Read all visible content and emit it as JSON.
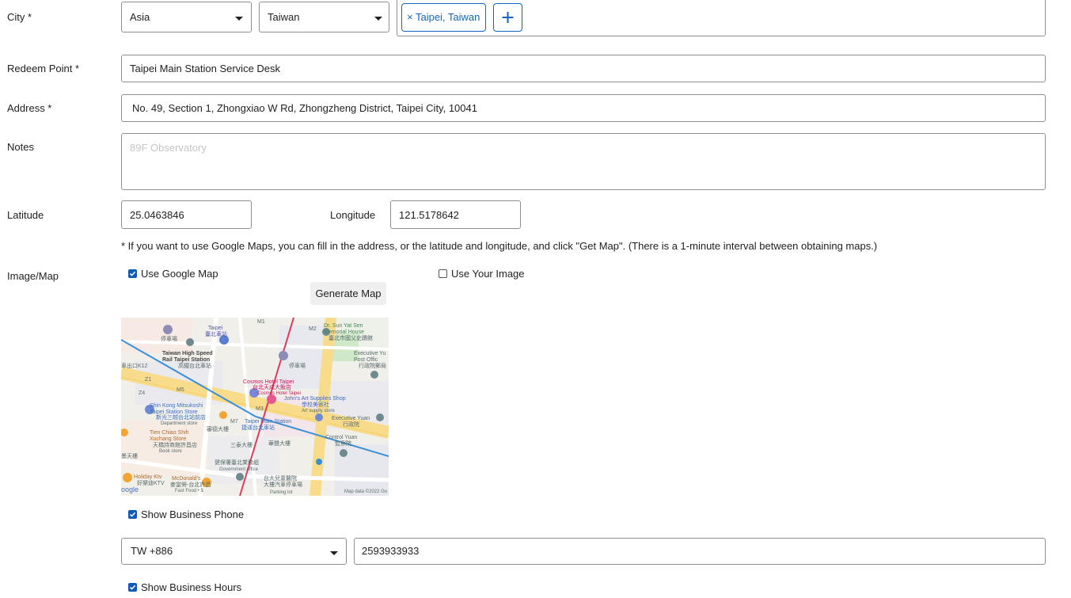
{
  "city": {
    "label": "City *",
    "region_select": "Asia",
    "country_select": "Taiwan",
    "selected_tags": [
      "× Taipei, Taiwan"
    ]
  },
  "redeem_point": {
    "label": "Redeem Point *",
    "value": "Taipei Main Station Service Desk"
  },
  "address": {
    "label": "Address *",
    "value": "No. 49, Section 1, Zhongxiao W Rd, Zhongzheng District, Taipei City, 10041"
  },
  "notes": {
    "label": "Notes",
    "placeholder": "89F Observatory"
  },
  "coordinates": {
    "latitude_label": "Latitude",
    "latitude_value": "25.0463846",
    "longitude_label": "Longitude",
    "longitude_value": "121.5178642",
    "hint": "* If you want to use Google Maps, you can fill in the address, or the latitude and longitude, and click \"Get Map\". (There is a 1-minute interval between obtaining maps.)"
  },
  "image_map": {
    "label": "Image/Map",
    "use_google_map_label": "Use Google Map",
    "use_google_map_checked": true,
    "use_your_image_label": "Use Your Image",
    "use_your_image_checked": false,
    "generate_button": "Generate Map",
    "map_labels": {
      "taipei": "Taipei",
      "taipei_zh": "臺北車站",
      "parking1": "停車場",
      "hsr": "Taiwan High Speed\nRail Taipei Station",
      "hsr_zh": "高鐵台北車站",
      "m1": "M1",
      "m2": "M2",
      "sun": "Dr. Sun Yat Sen\nMemorial House",
      "sun_zh": "臺北市國父史蹟館",
      "parking2": "停車場",
      "k12": "車出口K12",
      "z1": "Z1",
      "z4": "Z4",
      "m5": "M5",
      "cosmos": "Cosmos Hotel Taipei",
      "cosmos_zh": "台北天成大飯店",
      "cosmos_sub": "Cosmos Hotel Taipei",
      "exec_yuan_post": "Executive Yu\nPost Offic",
      "exec_yuan_post_zh": "行政院郵局",
      "johns": "John's Art Supplies Shop",
      "johns_zh": "學校美術社",
      "johns_sub": "Art supply store",
      "shinkong": "Shin Kong Mitsukoshi\nTaipei Station Store",
      "shinkong_zh": "新光三越台北站前店",
      "shinkong_sub": "Department store",
      "m3": "M3",
      "exec_yuan": "Executive Yuan",
      "exec_yuan_zh": "行政院",
      "m7": "M7",
      "tms": "Taipei Main Station",
      "tms_zh": "捷運台北車站",
      "tms_area": "審德大樓",
      "control_yuan": "Control Yuan",
      "control_yuan_zh": "監察院",
      "tianchiao": "Tien Chiao Shih\nXuchang Store",
      "tianchiao_zh": "天橋詩商館許昌店",
      "tianchiao_sub": "Book store",
      "bldg1": "三泰大樓",
      "bldg2": "華聲大樓",
      "bldg3": "三泰大樓",
      "gov": "健保署臺北業務組",
      "gov_sub": "Government office",
      "holiday": "Holiday Ktv",
      "holiday_zh": "好樂迪KTV",
      "mcd": "McDonald's",
      "mcd_zh": "麥當勞-台北許昌",
      "mcd_sub": "Fast Food • $",
      "parking3": "台大兒童醫院\n大樓汽車停車場",
      "parking3_sub": "Parking lot",
      "left_building": "墨天樓",
      "google": "oogle",
      "copyright": "Map data ©2022 Go"
    }
  },
  "business_phone": {
    "label": "Show Business Phone",
    "checked": true,
    "country_code": "TW +886",
    "number": "2593933933"
  },
  "business_hours": {
    "label": "Show Business Hours",
    "checked": true
  },
  "colors": {
    "accent": "#0f5bb5",
    "tag_blue": "#1565c0",
    "border": "#8f8f8f"
  }
}
